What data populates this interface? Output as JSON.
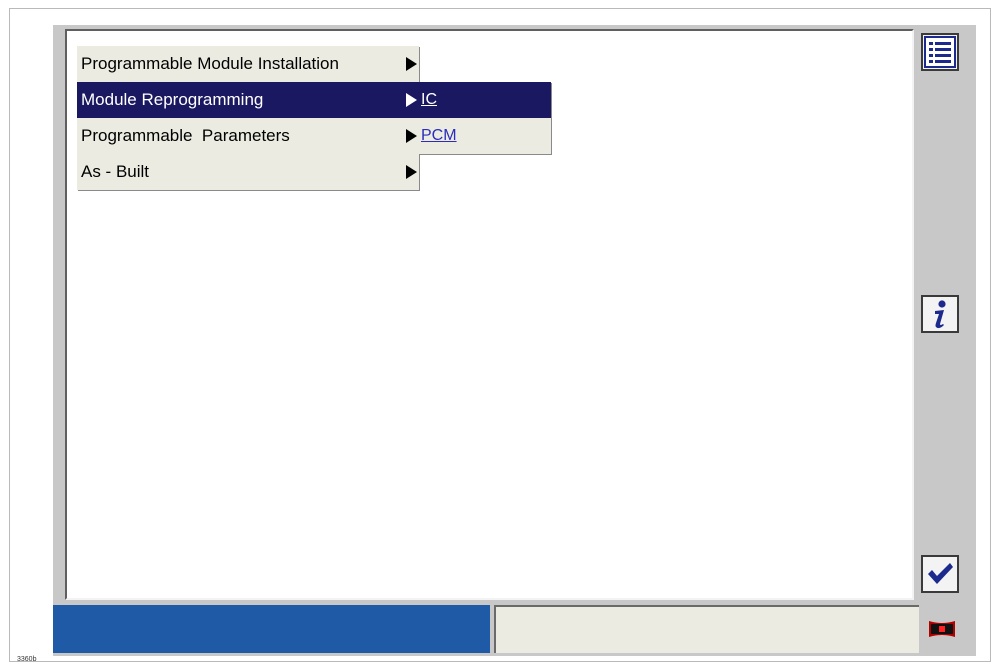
{
  "menu": {
    "items": [
      {
        "label": "Programmable Module Installation",
        "has_submenu": true
      },
      {
        "label": "Module Reprogramming",
        "has_submenu": true,
        "selected": true
      },
      {
        "label": "Programmable  Parameters",
        "has_submenu": true
      },
      {
        "label": "As - Built",
        "has_submenu": true
      }
    ]
  },
  "submenu": {
    "items": [
      {
        "label": "IC",
        "selected": true
      },
      {
        "label": "PCM"
      }
    ]
  },
  "sidebar": {
    "list_icon": "list-icon",
    "info_icon": "info-icon",
    "confirm_icon": "checkmark-icon"
  },
  "statusbar": {
    "progress": 0.51,
    "connection_icon": "vehicle-connector-icon"
  },
  "caption": "3360b",
  "colors": {
    "selection": "#1a1860",
    "progress": "#1f5aa6",
    "menu_bg": "#ecebe1",
    "icon_blue": "#1b2a8c"
  }
}
